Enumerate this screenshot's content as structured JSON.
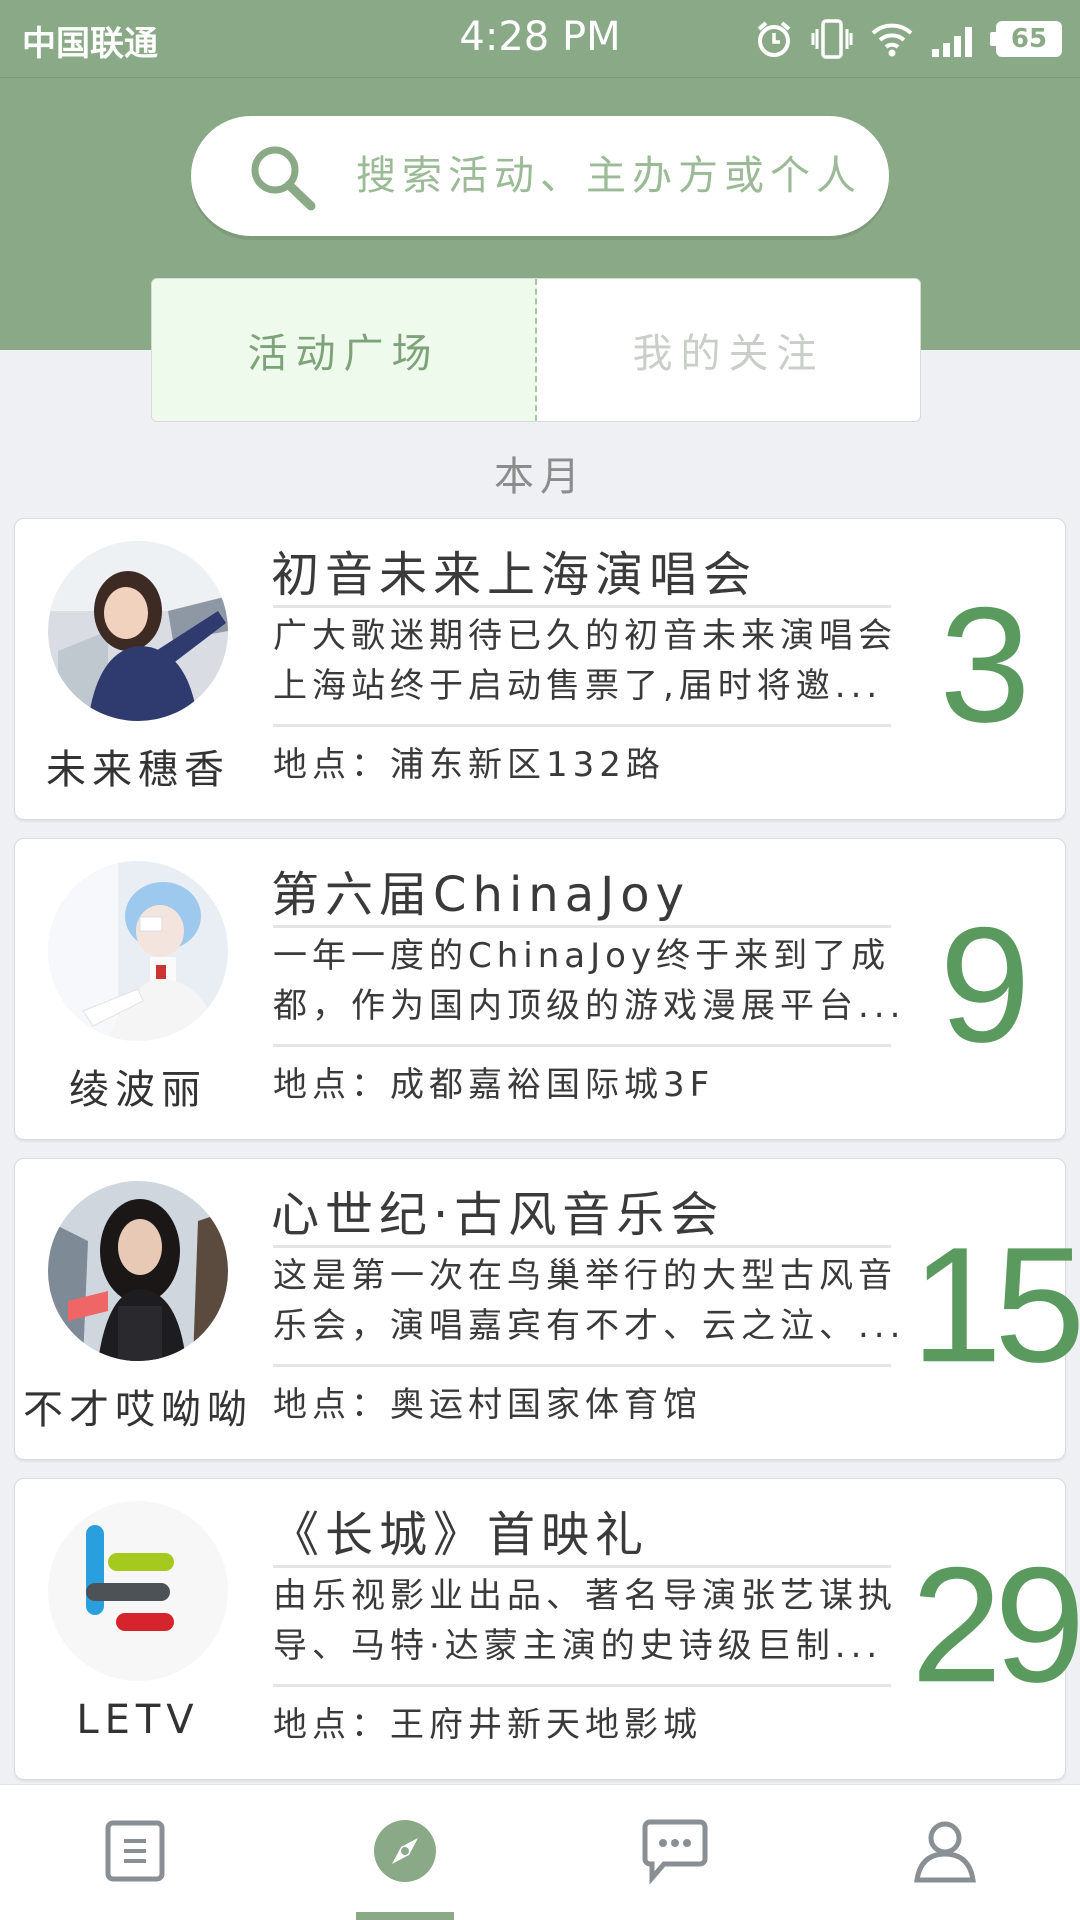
{
  "status_bar": {
    "carrier": "中国联通",
    "time": "4:28 PM",
    "battery": "65"
  },
  "search": {
    "placeholder": "搜索活动、主办方或个人"
  },
  "tabs": [
    {
      "label": "活动广场",
      "active": true
    },
    {
      "label": "我的关注",
      "active": false
    }
  ],
  "section_label": "本月",
  "events": [
    {
      "host": "未来穗香",
      "title": "初音未来上海演唱会",
      "desc_lines": [
        "广大歌迷期待已久的初音未来演唱会",
        "上海站终于启动售票了,届时将邀..."
      ],
      "location": "地点：浦东新区132路",
      "day": "3",
      "avatar_icon": "person-photo-avatar"
    },
    {
      "host": "绫波丽",
      "title": "第六届ChinaJoy",
      "desc_lines": [
        "一年一度的ChinaJoy终于来到了成",
        "都，作为国内顶级的游戏漫展平台..."
      ],
      "location": "地点：成都嘉裕国际城3F",
      "day": "9",
      "avatar_icon": "cosplay-photo-avatar"
    },
    {
      "host": "不才哎呦呦",
      "title": "心世纪·古风音乐会",
      "desc_lines": [
        "这是第一次在鸟巢举行的大型古风音",
        "乐会，演唱嘉宾有不才、云之泣、..."
      ],
      "location": "地点：奥运村国家体育馆",
      "day": "15",
      "avatar_icon": "singer-photo-avatar"
    },
    {
      "host": "LETV",
      "title": "《长城》首映礼",
      "desc_lines": [
        "由乐视影业出品、著名导演张艺谋执",
        "导、马特·达蒙主演的史诗级巨制..."
      ],
      "location": "地点：王府井新天地影城",
      "day": "29",
      "avatar_icon": "letv-logo"
    }
  ],
  "bottom_nav": [
    {
      "icon": "document-list-icon",
      "active": false
    },
    {
      "icon": "compass-icon",
      "active": true
    },
    {
      "icon": "chat-bubble-icon",
      "active": false
    },
    {
      "icon": "user-profile-icon",
      "active": false
    }
  ],
  "colors": {
    "primary_green": "#8aa986",
    "date_green": "#5b9a5e",
    "background": "#eef0f3"
  }
}
